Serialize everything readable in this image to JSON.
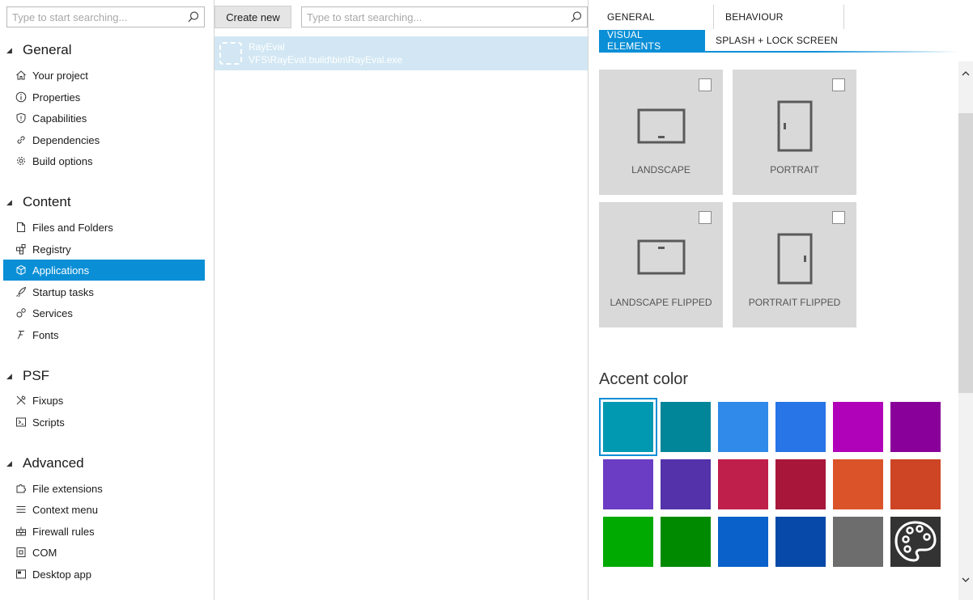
{
  "left_search": {
    "placeholder": "Type to start searching..."
  },
  "nav": {
    "groups": [
      {
        "label": "General",
        "items": [
          "Your project",
          "Properties",
          "Capabilities",
          "Dependencies",
          "Build options"
        ]
      },
      {
        "label": "Content",
        "items": [
          "Files and Folders",
          "Registry",
          "Applications",
          "Startup tasks",
          "Services",
          "Fonts"
        ]
      },
      {
        "label": "PSF",
        "items": [
          "Fixups",
          "Scripts"
        ]
      },
      {
        "label": "Advanced",
        "items": [
          "File extensions",
          "Context menu",
          "Firewall rules",
          "COM",
          "Desktop app"
        ]
      }
    ],
    "selected": "Applications"
  },
  "middle": {
    "create_label": "Create new",
    "search_placeholder": "Type to start searching...",
    "app": {
      "name": "RayEval",
      "path": "VFS\\RayEval.build\\bin\\RayEval.exe"
    }
  },
  "tabs": {
    "general": "GENERAL",
    "behaviour": "BEHAVIOUR",
    "visual": "VISUAL ELEMENTS",
    "splash": "SPLASH + LOCK SCREEN",
    "active": "VISUAL ELEMENTS"
  },
  "orientations": {
    "landscape": "LANDSCAPE",
    "portrait": "PORTRAIT",
    "landscape_flipped": "LANDSCAPE FLIPPED",
    "portrait_flipped": "PORTRAIT FLIPPED",
    "checked": {
      "landscape": false,
      "portrait": false,
      "landscape_flipped": false,
      "portrait_flipped": false
    }
  },
  "accent": {
    "title": "Accent color",
    "selected_index": 0,
    "colors": [
      "#0199b2",
      "#018699",
      "#2f8ae9",
      "#2775e7",
      "#b002b8",
      "#880099",
      "#6a3dc4",
      "#5332aa",
      "#bf1f4b",
      "#a8173a",
      "#db5329",
      "#cd4525",
      "#00aa00",
      "#008a00",
      "#0a61c9",
      "#0749a8",
      "#6d6d6d",
      "#333333"
    ],
    "custom_icon": "palette-icon"
  },
  "icons": {
    "search": "search-icon",
    "your_project": "home-icon",
    "properties": "info-icon",
    "capabilities": "shield-icon",
    "dependencies": "link-icon",
    "build_options": "gear-icon",
    "files": "file-icon",
    "registry": "registry-icon",
    "applications": "cube-icon",
    "startup": "rocket-icon",
    "services": "gears-icon",
    "fonts": "font-icon",
    "fixups": "tools-icon",
    "scripts": "script-icon",
    "file_extensions": "puzzle-icon",
    "context_menu": "menu-icon",
    "firewall": "firewall-icon",
    "com": "com-icon",
    "desktop_app": "window-icon"
  }
}
